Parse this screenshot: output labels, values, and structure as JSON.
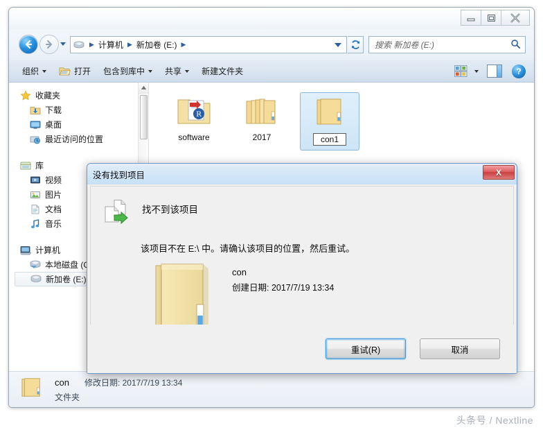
{
  "window": {
    "controls": {
      "minimize": "minimize-icon",
      "maximize": "maximize-icon",
      "close": "close-icon"
    }
  },
  "navigation": {
    "back_icon": "back-arrow-icon",
    "forward_icon": "forward-arrow-icon",
    "recent_pages_icon": "chevron-down-icon",
    "breadcrumb": {
      "drive_icon": "hard-drive-icon",
      "crumbs": [
        "计算机",
        "新加卷 (E:)"
      ],
      "separator": "▶",
      "dropdown_icon": "chevron-down-icon"
    },
    "refresh_label": "↻",
    "refresh_icon": "refresh-icon"
  },
  "search": {
    "placeholder": "搜索 新加卷 (E:)",
    "value": "",
    "icon": "search-icon"
  },
  "toolbar": {
    "items": [
      {
        "label": "组织",
        "caret": true,
        "icon": null
      },
      {
        "label": "打开",
        "caret": false,
        "icon": "open-folder-icon"
      },
      {
        "label": "包含到库中",
        "caret": true,
        "icon": null
      },
      {
        "label": "共享",
        "caret": true,
        "icon": null
      },
      {
        "label": "新建文件夹",
        "caret": false,
        "icon": null
      }
    ],
    "view_options_icon": "view-layout-icon",
    "view_options_caret": "chevron-down-icon",
    "preview_pane_icon": "preview-pane-icon",
    "help_label": "?",
    "help_icon": "help-icon"
  },
  "sidebar": {
    "groups": [
      {
        "header": {
          "label": "收藏夹",
          "icon": "star-icon"
        },
        "items": [
          {
            "label": "下载",
            "icon": "downloads-icon"
          },
          {
            "label": "桌面",
            "icon": "desktop-icon"
          },
          {
            "label": "最近访问的位置",
            "icon": "recent-places-icon"
          }
        ]
      },
      {
        "header": {
          "label": "库",
          "icon": "library-icon"
        },
        "items": [
          {
            "label": "视频",
            "icon": "videos-icon"
          },
          {
            "label": "图片",
            "icon": "pictures-icon"
          },
          {
            "label": "文档",
            "icon": "documents-icon"
          },
          {
            "label": "音乐",
            "icon": "music-icon"
          }
        ]
      },
      {
        "header": {
          "label": "计算机",
          "icon": "computer-icon"
        },
        "items": [
          {
            "label": "本地磁盘 (C:)",
            "icon": "local-disk-icon",
            "selected": false
          },
          {
            "label": "新加卷 (E:)",
            "icon": "hard-drive-icon",
            "selected": true
          }
        ]
      }
    ],
    "scrollbar_up_icon": "scroll-up-icon"
  },
  "file_list": {
    "items": [
      {
        "name": "software",
        "icon": "folder-with-installer-icon",
        "selected": false,
        "editing": false
      },
      {
        "name": "2017",
        "icon": "folder-stack-icon",
        "selected": false,
        "editing": false
      },
      {
        "name": "con1",
        "icon": "folder-icon",
        "selected": true,
        "editing": true
      }
    ]
  },
  "details_pane": {
    "icon": "folder-icon",
    "name": "con",
    "modified_label": "修改日期: 2017/7/19 13:34",
    "type": "文件夹"
  },
  "dialog": {
    "title": "没有找到项目",
    "close_label": "X",
    "close_icon": "close-icon",
    "headline_icon": "move-file-icon",
    "headline": "找不到该项目",
    "message": "该项目不在 E:\\ 中。请确认该项目的位置，然后重试。",
    "item_icon": "folder-icon",
    "item_name": "con",
    "item_date": "创建日期: 2017/7/19 13:34",
    "buttons": [
      {
        "label": "重试(R)",
        "default": true
      },
      {
        "label": "取消",
        "default": false
      }
    ]
  },
  "watermark": "头条号 / Nextline",
  "colors": {
    "accent_blue": "#3c9ddd",
    "close_red": "#c93f3f",
    "folder_yellow": "#f2dd9a",
    "selection_blue": "#cde5f7",
    "toolbar_blue": "#dbe6f1"
  }
}
